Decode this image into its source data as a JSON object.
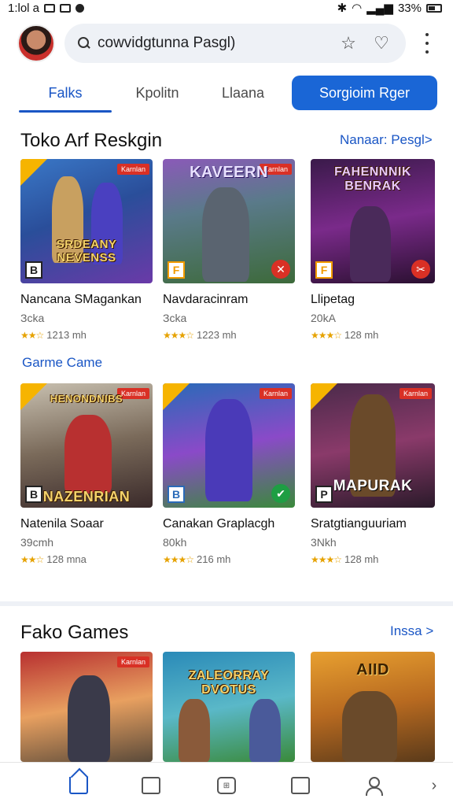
{
  "status_bar": {
    "time": "1:lol a",
    "battery": "33%"
  },
  "header": {
    "search_value": "cowvidgtunna Pasgl)",
    "search_placeholder": "cowvidgtunna Pasgl)",
    "star_icon": "star-icon",
    "heart_icon": "heart-icon"
  },
  "tabs": [
    {
      "label": "Falks"
    },
    {
      "label": "Kpolitn"
    },
    {
      "label": "Llaana"
    },
    {
      "label": "Sorgioim Rger"
    }
  ],
  "section1": {
    "title": "Toko Arf Reskgin",
    "link": "Nanaar: Pesgl>"
  },
  "row1": [
    {
      "name": "Nancana SMagankan",
      "sub": "Зcka",
      "rating": "1213 mh",
      "art": "SRDEANY NEVENSS",
      "flag": "Karnlan",
      "badge": "B",
      "action": "⚔"
    },
    {
      "name": "Navdaracinram",
      "sub": "Зcka",
      "rating": "1223 mh",
      "art": "KAVEERN",
      "flag": "Karnlan",
      "badge": "F",
      "action": "✕"
    },
    {
      "name": "Llipetag",
      "sub": "20kA",
      "rating": "128 mh",
      "art": "FAHENNNIK BENRAK",
      "flag": "",
      "badge": "F",
      "action": "✂"
    }
  ],
  "group_label": "Garme Came",
  "row2": [
    {
      "name": "Natenila Soaar",
      "sub": "39cmh",
      "rating": "128 mna",
      "art": "NAZENRIAN",
      "art_top": "HENONDNIBS",
      "flag": "Karnlan",
      "badge": "B",
      "action": "⚔"
    },
    {
      "name": "Canakan Graplacgh",
      "sub": "80kh",
      "rating": "216 mh",
      "art": "",
      "flag": "Karnlan",
      "badge": "B",
      "action": "✔"
    },
    {
      "name": "Sratgtianguuriam",
      "sub": "3Nkh",
      "rating": "128 mh",
      "art": "MAPURAK",
      "flag": "Karnlan",
      "badge": "P",
      "action": ""
    }
  ],
  "section2": {
    "title": "Fako Games",
    "link": "Inssa >"
  },
  "row3": [
    {
      "art": "",
      "flag": "Karnlan"
    },
    {
      "art": "ZALEORRAY DVOTUS",
      "flag": ""
    },
    {
      "art": "AIID",
      "flag": ""
    }
  ],
  "colors": {
    "accent": "#1a56c5",
    "primary_button": "#1a66d6",
    "flag_red": "#d93025",
    "star_yellow": "#e6a200"
  },
  "bottom_nav": [
    "home-icon",
    "square-icon",
    "apps-icon",
    "square-icon",
    "person-icon",
    "chevron-right-icon"
  ]
}
